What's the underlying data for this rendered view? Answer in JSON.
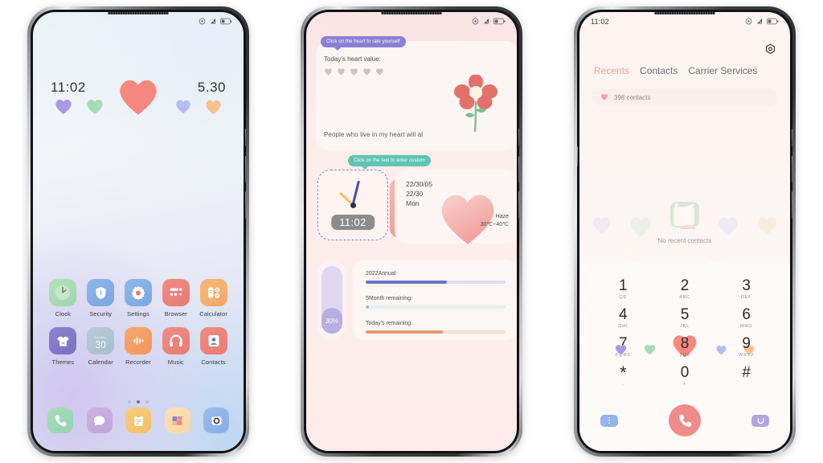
{
  "colors": {
    "accent_pink": "#ef8c88",
    "tab_active": "#f0a0a0",
    "purple_bubble": "#8b7fd4",
    "teal_bubble": "#5fc3b4",
    "heart_purple": "#a79ae2",
    "heart_green": "#a5dcb5",
    "heart_red": "#f6897f",
    "heart_blue": "#b4bdee",
    "heart_orange": "#f8c18a",
    "progress_blue": "#6f72c9",
    "progress_green": "#7ecfc0",
    "progress_orange": "#e09a70"
  },
  "phone1": {
    "status": {
      "time": "",
      "icons": [
        "location-icon",
        "signal-icon",
        "battery-icon"
      ]
    },
    "widget": {
      "time": "11:02",
      "date": "5.30",
      "hearts": [
        "purple",
        "green",
        "red",
        "blue",
        "orange"
      ]
    },
    "apps": [
      {
        "label": "Clock",
        "icon": "clock-icon"
      },
      {
        "label": "Security",
        "icon": "shield-icon"
      },
      {
        "label": "Settings",
        "icon": "gear-icon"
      },
      {
        "label": "Browser",
        "icon": "browser-icon"
      },
      {
        "label": "Calculator",
        "icon": "calculator-icon"
      },
      {
        "label": "Themes",
        "icon": "shirt-icon"
      },
      {
        "label": "Calendar",
        "icon": "calendar-icon"
      },
      {
        "label": "Recorder",
        "icon": "recorder-icon"
      },
      {
        "label": "Music",
        "icon": "headphones-icon"
      },
      {
        "label": "Contacts",
        "icon": "contacts-icon"
      }
    ],
    "calendar_icon": {
      "month": "Monthly",
      "day": "30"
    },
    "page_dots": {
      "count": 3,
      "active_index": 1
    },
    "dock": [
      {
        "icon": "phone-icon"
      },
      {
        "icon": "messages-icon"
      },
      {
        "icon": "notes-icon"
      },
      {
        "icon": "gallery-icon"
      },
      {
        "icon": "camera-icon"
      }
    ]
  },
  "phone2": {
    "status": {
      "time": "",
      "icons": [
        "location-icon",
        "signal-icon",
        "battery-icon"
      ]
    },
    "heart_widget": {
      "tip": "Click on the heart to rate yourself",
      "title": "Today's heart value:",
      "hearts_count": 5,
      "quote": "People who live in my heart will al",
      "tip2": "Click on the text to enter custom",
      "flower_icon": "flower-icon"
    },
    "clock_widget": {
      "time": "11:02"
    },
    "weather_widget": {
      "date_line1": "22/30/05",
      "date_line2": "22/30",
      "weekday": "Mon",
      "condition": "Haze",
      "temperature": "30℃~40℃"
    },
    "battery_widget": {
      "percent": "30%",
      "value": 30
    },
    "progress_widget": [
      {
        "label": "2022Annual:",
        "value": 58,
        "color": "#6f72c9"
      },
      {
        "label": "5Month remaining:",
        "value": 2,
        "color": "#7ecfc0"
      },
      {
        "label": "Today's remaining:",
        "value": 55,
        "color": "#e09a70"
      }
    ]
  },
  "phone3": {
    "status": {
      "time": "11:02",
      "icons": [
        "location-icon",
        "signal-icon",
        "battery-icon"
      ]
    },
    "settings_icon": "gear-icon",
    "tabs": [
      {
        "label": "Recents",
        "active": true
      },
      {
        "label": "Contacts",
        "active": false
      },
      {
        "label": "Carrier Services",
        "active": false
      }
    ],
    "search": {
      "icon": "heart-icon",
      "text": "398 contacts"
    },
    "empty_state": {
      "icon": "empty-box-icon",
      "text": "No recent contacts"
    },
    "dialpad": [
      {
        "num": "1",
        "sub": "QD"
      },
      {
        "num": "2",
        "sub": "ABC"
      },
      {
        "num": "3",
        "sub": "DEF"
      },
      {
        "num": "4",
        "sub": "QHI"
      },
      {
        "num": "5",
        "sub": "JKL"
      },
      {
        "num": "6",
        "sub": "MNO"
      },
      {
        "num": "7",
        "sub": "PQRS"
      },
      {
        "num": "8",
        "sub": "TUV"
      },
      {
        "num": "9",
        "sub": "WXYZ"
      },
      {
        "num": "*",
        "sub": ","
      },
      {
        "num": "0",
        "sub": "+"
      },
      {
        "num": "#",
        "sub": ""
      }
    ],
    "actions": {
      "more_icon": "more-vertical-icon",
      "call_icon": "phone-icon",
      "keyboard_icon": "hide-keypad-icon"
    }
  }
}
